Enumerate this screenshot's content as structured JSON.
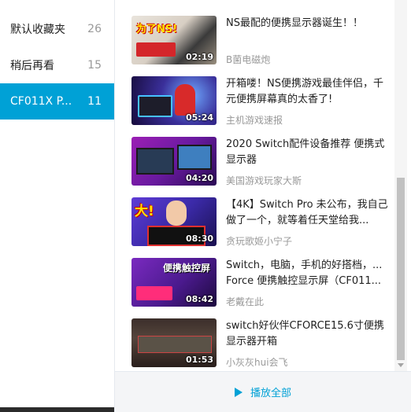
{
  "sidebar": {
    "folders": [
      {
        "name": "默认收藏夹",
        "count": "26"
      },
      {
        "name": "稍后再看",
        "count": "15"
      },
      {
        "name": "CF011X P...",
        "count": "11"
      }
    ]
  },
  "videos": [
    {
      "title": "NS最配的便携显示器诞生！！",
      "uploader": "B菌电磁炮",
      "duration": "02:19",
      "caption": "为了NS!"
    },
    {
      "title": "开箱喽！NS便携游戏最佳伴侣，千元便携屏幕真的太香了!",
      "uploader": "主机游戏速报",
      "duration": "05:24",
      "caption": ""
    },
    {
      "title": "2020 Switch配件设备推荐 便携式显示器",
      "uploader": "美国游戏玩家大斯",
      "duration": "04:20",
      "caption": ""
    },
    {
      "title": "【4K】Switch Pro 未公布，我自己做了一个，就等着任天堂给我...",
      "uploader": "贪玩歌姬小宁子",
      "duration": "08:30",
      "caption": "大!"
    },
    {
      "title": "Switch，电脑，手机的好搭档，... Force 便携触控显示屏（CF011...",
      "uploader": "老戴在此",
      "duration": "08:42",
      "caption": "便携触控屏"
    },
    {
      "title": "switch好伙伴CFORCE15.6寸便携显示器开箱",
      "uploader": "小灰灰hui会飞",
      "duration": "01:53",
      "caption": ""
    }
  ],
  "footer": {
    "play_all": "播放全部"
  },
  "colors": {
    "accent": "#00a1d6",
    "muted": "#999999"
  }
}
